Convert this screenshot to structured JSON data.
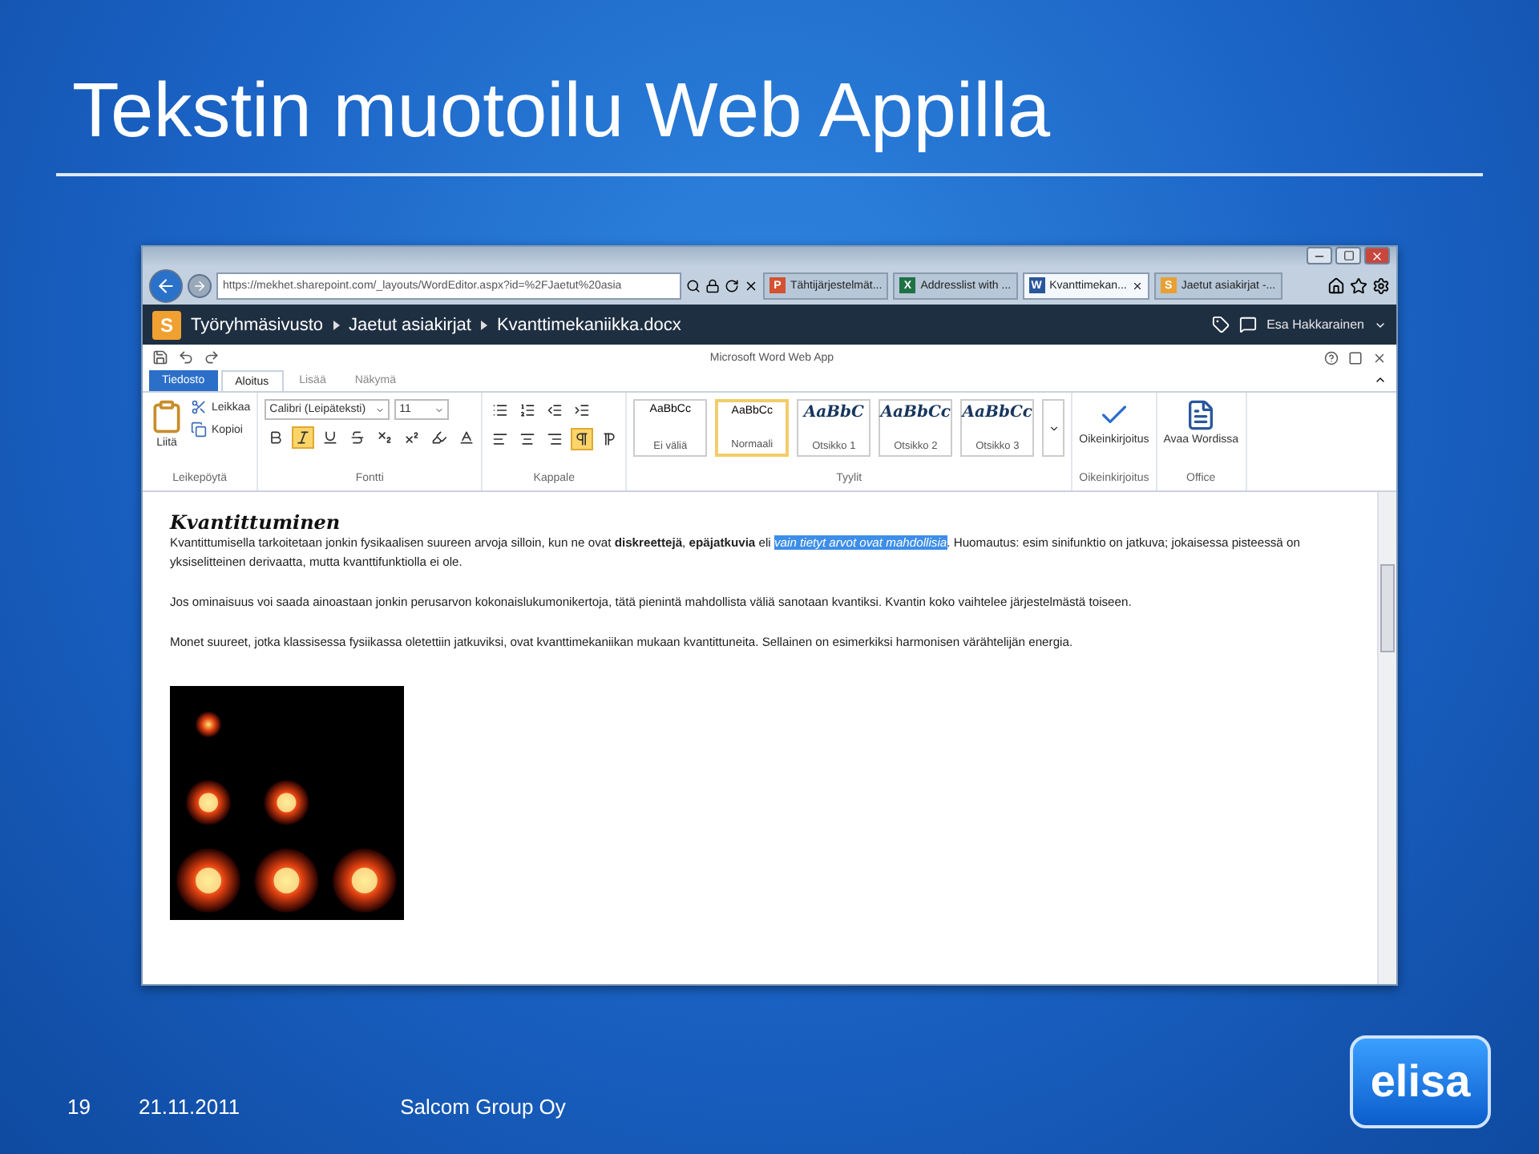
{
  "slide": {
    "title": "Tekstin muotoilu Web Appilla"
  },
  "browser": {
    "url": "https://mekhet.sharepoint.com/_layouts/WordEditor.aspx?id=%2FJaetut%20asia",
    "tabs": [
      {
        "badge": "P",
        "color": "#d35230",
        "label": "Tähtijärjestelmät...",
        "selected": false
      },
      {
        "badge": "X",
        "color": "#1e7145",
        "label": "Addresslist with ...",
        "selected": false
      },
      {
        "badge": "W",
        "color": "#2b579a",
        "label": "Kvanttimekan...",
        "selected": true
      },
      {
        "badge": "S",
        "color": "#e8a033",
        "label": "Jaetut asiakirjat -...",
        "selected": false
      }
    ]
  },
  "sharepoint": {
    "logo": "S",
    "breadcrumb": [
      "Työryhmäsivusto",
      "Jaetut asiakirjat",
      "Kvanttimekaniikka.docx"
    ],
    "user": "Esa Hakkarainen"
  },
  "app": {
    "title": "Microsoft Word Web App",
    "ribbon_tabs": [
      {
        "label": "Tiedosto",
        "kind": "file",
        "selected": false
      },
      {
        "label": "Aloitus",
        "kind": "tab",
        "selected": true
      },
      {
        "label": "Lisää",
        "kind": "tab",
        "selected": false
      },
      {
        "label": "Näkymä",
        "kind": "tab",
        "selected": false
      }
    ],
    "clipboard": {
      "paste": "Liitä",
      "cut": "Leikkaa",
      "copy": "Kopioi",
      "group": "Leikepöytä"
    },
    "font": {
      "name": "Calibri (Leipäteksti)",
      "size": "11",
      "group": "Fontti",
      "buttons": [
        {
          "kind": "bold",
          "on": false
        },
        {
          "kind": "italic",
          "on": true
        },
        {
          "kind": "underline",
          "on": false
        },
        {
          "kind": "strike",
          "on": false
        },
        {
          "kind": "subscript",
          "on": false
        },
        {
          "kind": "superscript",
          "on": false
        },
        {
          "kind": "highlight",
          "on": false
        },
        {
          "kind": "fontcolor",
          "on": false
        }
      ]
    },
    "paragraph": {
      "group": "Kappale",
      "buttons": [
        {
          "kind": "left",
          "on": false
        },
        {
          "kind": "center",
          "on": false
        },
        {
          "kind": "right",
          "on": false
        },
        {
          "kind": "ltr",
          "on": true
        },
        {
          "kind": "rtl",
          "on": false
        }
      ]
    },
    "styles": {
      "group": "Tyylit",
      "items": [
        {
          "preview": "AaBbCc",
          "label": "Ei väliä",
          "kind": "plain",
          "selected": false
        },
        {
          "preview": "AaBbCc",
          "label": "Normaali",
          "kind": "plain",
          "selected": true
        },
        {
          "preview": "AaBbC",
          "label": "Otsikko 1",
          "kind": "heading",
          "selected": false
        },
        {
          "preview": "AaBbCc",
          "label": "Otsikko 2",
          "kind": "heading",
          "selected": false
        },
        {
          "preview": "AaBbCc",
          "label": "Otsikko 3",
          "kind": "heading",
          "selected": false
        }
      ]
    },
    "spelling": {
      "button": "Oikeinkirjoitus",
      "group": "Oikeinkirjoitus"
    },
    "office": {
      "button": "Avaa Wordissa",
      "group": "Office"
    }
  },
  "document": {
    "heading": "Kvantittuminen",
    "paragraphs": [
      {
        "before": "Kvantittumisella tarkoitetaan jonkin fysikaalisen suureen arvoja silloin, kun ne ovat **diskreettejä**, **epäjatkuvia** eli ",
        "highlight": "vain tietyt arvot ovat mahdollisia",
        "after": ". Huomautus: esim sinifunktio on jatkuva; jokaisessa pisteessä on yksiselitteinen derivaatta, mutta kvanttifunktiolla ei ole."
      },
      {
        "before": "Jos ominaisuus voi saada ainoastaan jonkin perusarvon kokonaislukumonikertoja, tätä pienintä mahdollista väliä sanotaan kvantiksi. Kvantin koko vaihtelee järjestelmästä toiseen."
      },
      {
        "before": "Monet suureet, jotka klassisessa fysiikassa oletettiin jatkuviksi, ovat kvanttimekaniikan mukaan kvantittuneita. Sellainen on esimerkiksi harmonisen värähtelijän energia."
      }
    ]
  },
  "footer": {
    "page": "19",
    "date": "21.11.2011",
    "company": "Salcom Group Oy",
    "logo": "elisa"
  }
}
